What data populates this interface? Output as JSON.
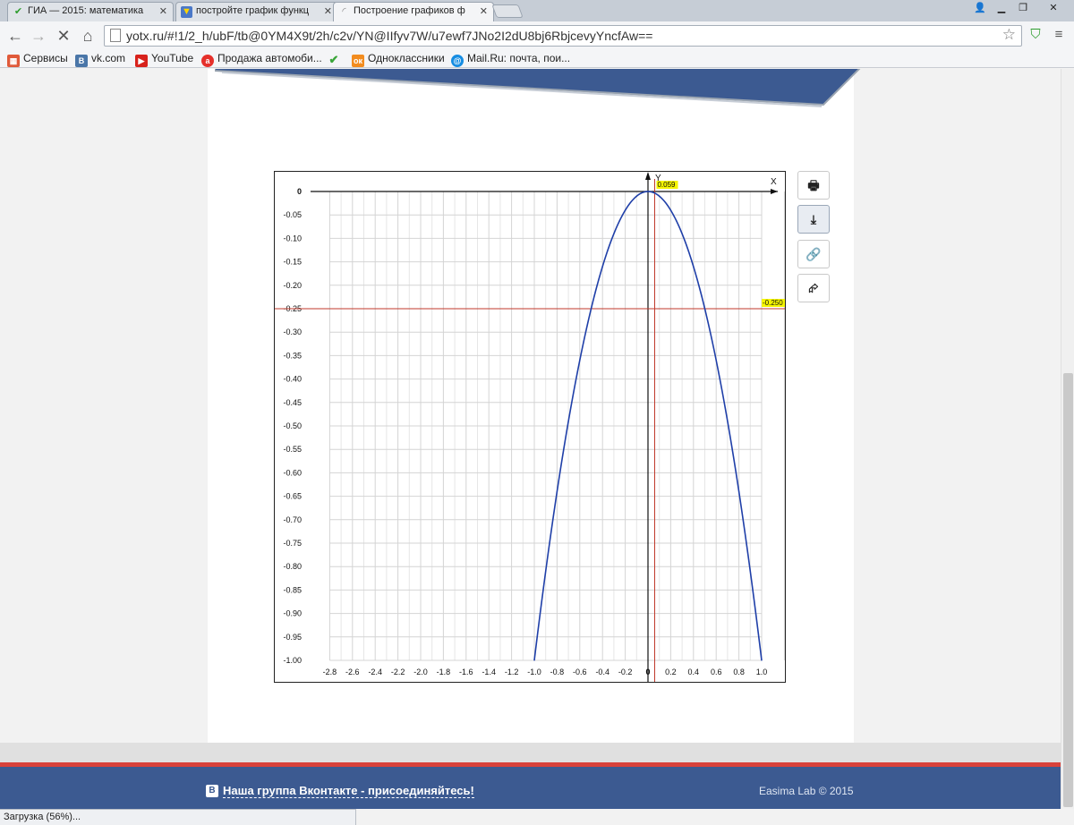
{
  "browser": {
    "tabs": [
      {
        "title": "ГИА — 2015: математика",
        "icon": "check-icon",
        "active": false
      },
      {
        "title": "постройте график функц",
        "icon": "lightbulb-icon",
        "active": false
      },
      {
        "title": "Построение графиков ф",
        "icon": "loading-spinner-icon",
        "active": true
      }
    ],
    "window_controls": [
      "user-icon",
      "minimize-icon",
      "restore-icon",
      "close-icon"
    ],
    "url": "yotx.ru/#!1/2_h/ubF/tb@0YM4X9t/2h/c2v/YN@IIfyv7W/u7ewf7JNo2I2dU8bj6RbjcevyYncfAw==",
    "bookmarks": [
      {
        "label": "Сервисы",
        "icon": "apps-grid-icon",
        "color": "#e05a3a"
      },
      {
        "label": "vk.com",
        "icon": "vk-icon",
        "color": "#4a76a8"
      },
      {
        "label": "YouTube",
        "icon": "youtube-icon",
        "color": "#d8221c"
      },
      {
        "label": "Продажа автомоби...",
        "icon": "auto-ru-icon",
        "color": "#e5302b"
      },
      {
        "label": "",
        "icon": "checkmark-icon",
        "color": "#3aa63a"
      },
      {
        "label": "Одноклассники",
        "icon": "odnoklassniki-icon",
        "color": "#f28c1f"
      },
      {
        "label": "Mail.Ru: почта, пои...",
        "icon": "mailru-icon",
        "color": "#168de2"
      }
    ],
    "status_text": "Загрузка (56%)..."
  },
  "colors": {
    "curve": "#1f3fa8",
    "marker_line": "#c0392b",
    "grid": "#d4d4d4",
    "label_highlight": "#f5f500",
    "footer_blue": "#3c5a91",
    "footer_red": "#d8413a"
  },
  "side_buttons": [
    {
      "name": "print-button",
      "icon": "printer-icon",
      "glyph": "🖶"
    },
    {
      "name": "download-button",
      "icon": "download-icon",
      "glyph": "⤓"
    },
    {
      "name": "link-button",
      "icon": "link-icon",
      "glyph": "🔗"
    },
    {
      "name": "share-button",
      "icon": "share-icon",
      "glyph": "⮳"
    }
  ],
  "chart_data": {
    "type": "line",
    "function": "y = -x^2",
    "xlabel": "X",
    "ylabel": "Y",
    "xlim": [
      -3.0,
      1.2
    ],
    "ylim": [
      -1.03,
      0.03
    ],
    "x_ticks": [
      -2.8,
      -2.6,
      -2.4,
      -2.2,
      -2.0,
      -1.8,
      -1.6,
      -1.4,
      -1.2,
      -1.0,
      -0.8,
      -0.6,
      -0.4,
      -0.2,
      0,
      0.2,
      0.4,
      0.6,
      0.8,
      1.0
    ],
    "x_tick_labels": [
      "-2.8",
      "-2.6",
      "-2.4",
      "-2.2",
      "-2.0",
      "-1.8",
      "-1.6",
      "-1.4",
      "-1.2",
      "-1.0",
      "-0.8",
      "-0.6",
      "-0.4",
      "-0.2",
      "0",
      "0.2",
      "0.4",
      "0.6",
      "0.8",
      "1.0"
    ],
    "y_ticks": [
      0,
      -0.05,
      -0.1,
      -0.15,
      -0.2,
      -0.25,
      -0.3,
      -0.35,
      -0.4,
      -0.45,
      -0.5,
      -0.55,
      -0.6,
      -0.65,
      -0.7,
      -0.75,
      -0.8,
      -0.85,
      -0.9,
      -0.95,
      -1.0
    ],
    "y_tick_labels": [
      "0",
      "-0.05",
      "-0.10",
      "-0.15",
      "-0.20",
      "-0.25",
      "-0.30",
      "-0.35",
      "-0.40",
      "-0.45",
      "-0.50",
      "-0.55",
      "-0.60",
      "-0.65",
      "-0.70",
      "-0.75",
      "-0.80",
      "-0.85",
      "-0.90",
      "-0.95",
      "-1.00"
    ],
    "series": [
      {
        "x": [
          -1.0,
          -0.9,
          -0.8,
          -0.7,
          -0.6,
          -0.5,
          -0.4,
          -0.3,
          -0.2,
          -0.1,
          0.0,
          0.1,
          0.2,
          0.3,
          0.4,
          0.5,
          0.6,
          0.7,
          0.8,
          0.9,
          1.0
        ],
        "y": [
          -1.0,
          -0.81,
          -0.64,
          -0.49,
          -0.36,
          -0.25,
          -0.16,
          -0.09,
          -0.04,
          -0.01,
          0.0,
          -0.01,
          -0.04,
          -0.09,
          -0.16,
          -0.25,
          -0.36,
          -0.49,
          -0.64,
          -0.81,
          -1.0
        ]
      }
    ],
    "cursor": {
      "x": 0.059,
      "y": -0.25,
      "x_label": "0.059",
      "y_label": "-0.250"
    },
    "grid": true
  }
}
